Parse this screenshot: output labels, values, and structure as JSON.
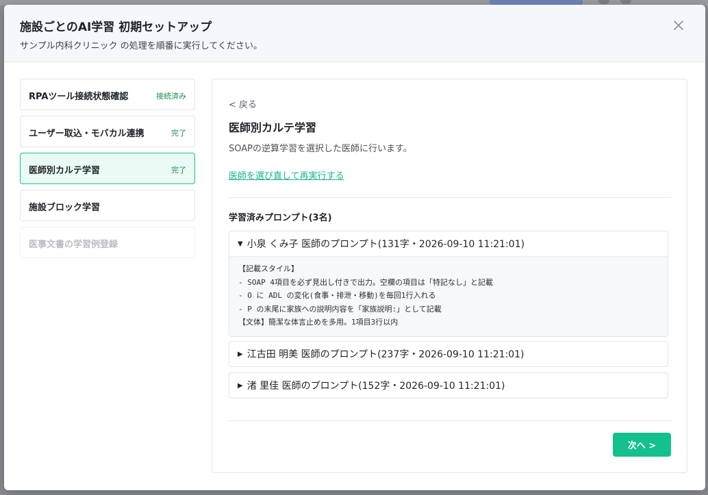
{
  "modal": {
    "title": "施設ごとのAI学習 初期セットアップ",
    "subtitle": "サンプル内科クリニック の処理を順番に実行してください。"
  },
  "steps": [
    {
      "label": "RPAツール接続状態確認",
      "status": "接続済み"
    },
    {
      "label": "ユーザー取込・モバカル連携",
      "status": "完了"
    },
    {
      "label": "医師別カルテ学習",
      "status": "完了"
    },
    {
      "label": "施設ブロック学習",
      "status": ""
    },
    {
      "label": "医事文書の学習例登録",
      "status": ""
    }
  ],
  "panel": {
    "back_label": "< 戻る",
    "title": "医師別カルテ学習",
    "description": "SOAPの逆算学習を選択した医師に行います。",
    "rerun_link": "医師を選び直して再実行する",
    "section_title": "学習済みプロンプト(3名)",
    "prompts": [
      {
        "arrow": "▼",
        "title": "小泉 くみ子 医師のプロンプト(131字・2026-09-10 11:21:01)",
        "body": [
          "【記載スタイル】",
          "- SOAP 4項目を必ず見出し付きで出力。空欄の項目は「特記なし」と記載",
          "- O に ADL の変化(食事・排泄・移動)を毎回1行入れる",
          "- P の末尾に家族への説明内容を「家族説明:」として記載",
          "【文体】簡潔な体言止めを多用。1項目3行以内"
        ]
      },
      {
        "arrow": "▶",
        "title": "江古田 明美 医師のプロンプト(237字・2026-09-10 11:21:01)"
      },
      {
        "arrow": "▶",
        "title": "渚 里佳 医師のプロンプト(152字・2026-09-10 11:21:01)"
      }
    ],
    "next_label": "次へ >"
  },
  "colors": {
    "accent": "#14c08d",
    "active_step_bg": "#eafaf4",
    "status_green": "#1f8a4c"
  }
}
